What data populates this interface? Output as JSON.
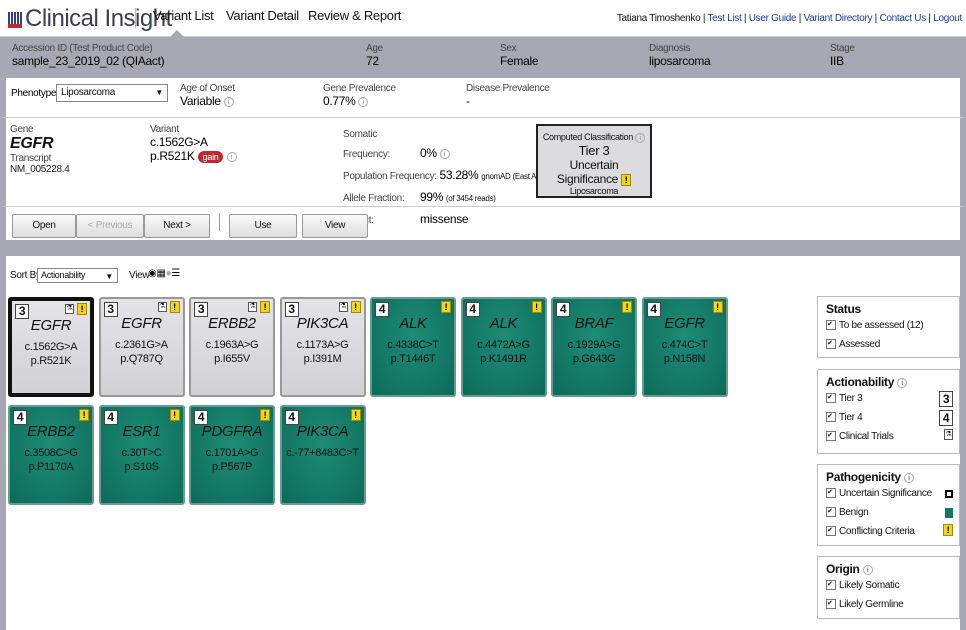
{
  "app": {
    "title": "Clinical Insight",
    "tabs": [
      "Variant List",
      "Variant Detail",
      "Review & Report"
    ],
    "user": "Tatiana Timoshenko",
    "links": [
      "Test List",
      "User Guide",
      "Variant Directory",
      "Contact Us",
      "Logout"
    ]
  },
  "patient": {
    "accession_label": "Accession ID (Test Product Code)",
    "accession": "sample_23_2019_02  (QIAact)",
    "age_label": "Age",
    "age": "72",
    "sex_label": "Sex",
    "sex": "Female",
    "diagnosis_label": "Diagnosis",
    "diagnosis": "liposarcoma",
    "stage_label": "Stage",
    "stage": "IIB"
  },
  "phenotype": {
    "label": "Phenotype:",
    "value": "Liposarcoma",
    "onset_label": "Age of Onset",
    "onset": "Variable",
    "gene_prev_label": "Gene Prevalence",
    "gene_prev": "0.77%",
    "disease_prev_label": "Disease Prevalence",
    "disease_prev": "-"
  },
  "variant": {
    "gene_label": "Gene",
    "gene": "EGFR",
    "transcript_label": "Transcript",
    "transcript": "NM_005228.4",
    "variant_label": "Variant",
    "c": "c.1562G>A",
    "p": "p.R521K",
    "badge": "gain",
    "somatic_label": "Somatic Frequency:",
    "somatic": "0%",
    "pop_label": "Population Frequency:",
    "pop": "53.28%",
    "pop_src": "gnomAD (East Asian)",
    "af_label": "Allele Fraction:",
    "af": "99%",
    "af_reads": "(of 3454 reads)",
    "impact_label": "Impact:",
    "impact": "missense",
    "cc_label": "Computed Classification",
    "cc_tier": "Tier 3",
    "cc_sig": "Uncertain Significance",
    "cc_pheno": "Liposarcoma"
  },
  "buttons": {
    "open": "Open",
    "prev": "< Previous",
    "next": "Next >",
    "use": "Use Classification",
    "biblio": "View Bibliography"
  },
  "list": {
    "sort_label": "Sort By",
    "sort_value": "Actionability",
    "view_label": "View"
  },
  "cards": [
    {
      "tier": "3",
      "gene": "EGFR",
      "c": "c.1562G>A",
      "p": "p.R521K",
      "trial": true,
      "selected": true
    },
    {
      "tier": "3",
      "gene": "EGFR",
      "c": "c.2361G>A",
      "p": "p.Q787Q",
      "trial": true
    },
    {
      "tier": "3",
      "gene": "ERBB2",
      "c": "c.1963A>G",
      "p": "p.I655V",
      "trial": true
    },
    {
      "tier": "3",
      "gene": "PIK3CA",
      "c": "c.1173A>G",
      "p": "p.I391M",
      "trial": true
    },
    {
      "tier": "4",
      "gene": "ALK",
      "c": "c.4338C>T",
      "p": "p.T1446T"
    },
    {
      "tier": "4",
      "gene": "ALK",
      "c": "c.4472A>G",
      "p": "p.K1491R"
    },
    {
      "tier": "4",
      "gene": "BRAF",
      "c": "c.1929A>G",
      "p": "p.G643G"
    },
    {
      "tier": "4",
      "gene": "EGFR",
      "c": "c.474C>T",
      "p": "p.N158N"
    },
    {
      "tier": "4",
      "gene": "ERBB2",
      "c": "c.3508C>G",
      "p": "p.P1170A"
    },
    {
      "tier": "4",
      "gene": "ESR1",
      "c": "c.30T>C",
      "p": "p.S10S"
    },
    {
      "tier": "4",
      "gene": "PDGFRA",
      "c": "c.1701A>G",
      "p": "p.P567P"
    },
    {
      "tier": "4",
      "gene": "PIK3CA",
      "c": "c.-77+8483C>T",
      "p": ""
    }
  ],
  "filters": {
    "status": {
      "title": "Status",
      "items": [
        "To be assessed (12)",
        "Assessed"
      ]
    },
    "actionability": {
      "title": "Actionability",
      "items": [
        "Tier 3",
        "Tier 4",
        "Clinical Trials"
      ],
      "tier3": "3",
      "tier4": "4"
    },
    "pathogenicity": {
      "title": "Pathogenicity",
      "items": [
        "Uncertain Significance",
        "Benign",
        "Conflicting Criteria"
      ]
    },
    "origin": {
      "title": "Origin",
      "items": [
        "Likely Somatic",
        "Likely Germline"
      ]
    }
  },
  "colors": {
    "benign": "#0f7a65",
    "warning": "#f3d515",
    "gain": "#c0282f",
    "header": "#a8a8b4"
  }
}
